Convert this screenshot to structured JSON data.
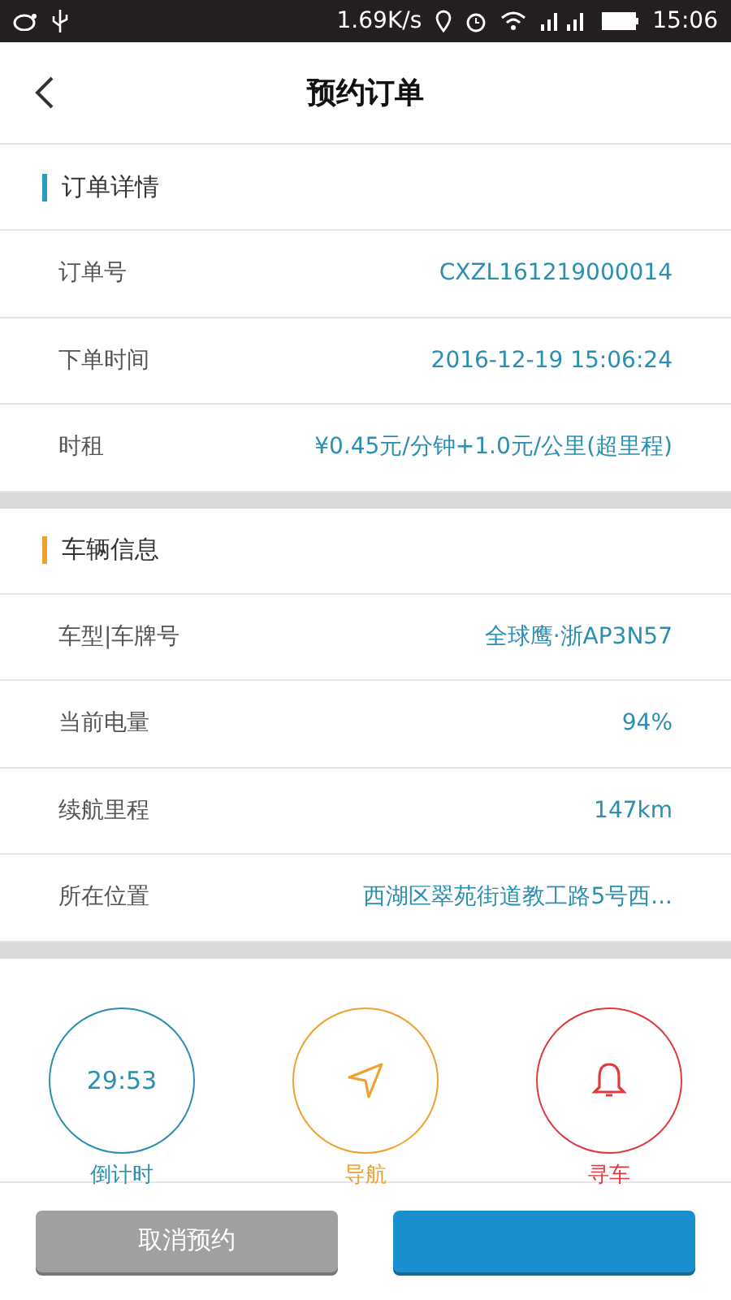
{
  "status_bar": {
    "speed": "1.69K/s",
    "time": "15:06"
  },
  "header": {
    "title": "预约订单"
  },
  "sections": [
    {
      "title": "订单详情",
      "color": "#2a9bbf",
      "rows": [
        {
          "label": "订单号",
          "value": "CXZL161219000014"
        },
        {
          "label": "下单时间",
          "value": "2016-12-19 15:06:24"
        },
        {
          "label": "时租",
          "value": "¥0.45元/分钟+1.0元/公里(超里程)"
        }
      ]
    },
    {
      "title": "车辆信息",
      "color": "#f0a030",
      "rows": [
        {
          "label": "车型|车牌号",
          "value": "全球鹰·浙AP3N57"
        },
        {
          "label": "当前电量",
          "value": "94%"
        },
        {
          "label": "续航里程",
          "value": "147km"
        },
        {
          "label": "所在位置",
          "value": "西湖区翠苑街道教工路5号西..."
        }
      ]
    }
  ],
  "actions": [
    {
      "kind": "timer",
      "text": "29:53",
      "label": "倒计时",
      "color": "#2a8fb0"
    },
    {
      "kind": "navigate",
      "label": "导航",
      "color": "#f0a030"
    },
    {
      "kind": "bell",
      "label": "寻车",
      "color": "#e0393e"
    }
  ],
  "buttons": [
    {
      "label": "取消预约",
      "kind": "secondary"
    },
    {
      "kind": "primary"
    }
  ]
}
